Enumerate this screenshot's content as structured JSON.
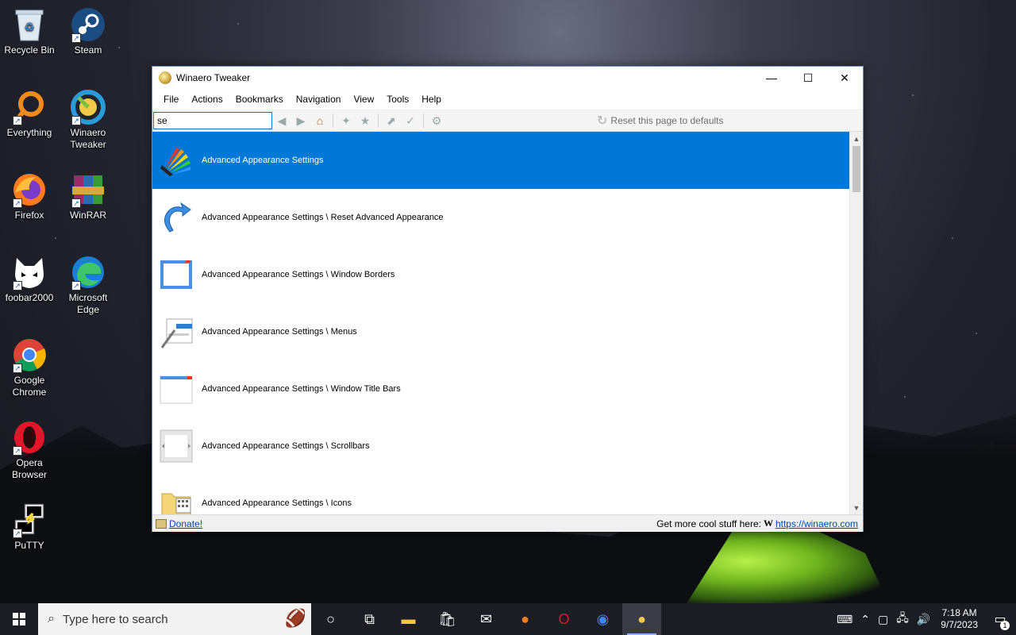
{
  "desktop": {
    "icons": [
      {
        "label": "Recycle Bin"
      },
      {
        "label": "Steam"
      },
      {
        "label": "Everything"
      },
      {
        "label": "Winaero Tweaker"
      },
      {
        "label": "Firefox"
      },
      {
        "label": "WinRAR"
      },
      {
        "label": "foobar2000"
      },
      {
        "label": "Microsoft Edge"
      },
      {
        "label": "Google Chrome"
      },
      {
        "label": "Opera Browser"
      },
      {
        "label": "PuTTY"
      }
    ]
  },
  "window": {
    "title": "Winaero Tweaker",
    "menu": [
      "File",
      "Actions",
      "Bookmarks",
      "Navigation",
      "View",
      "Tools",
      "Help"
    ],
    "search_value": "se",
    "reset_label": "Reset this page to defaults",
    "results": [
      {
        "label": "Advanced Appearance Settings",
        "icon": "palette-icon",
        "selected": true
      },
      {
        "label": "Advanced Appearance Settings \\ Reset Advanced Appearance",
        "icon": "reset-arrow-icon"
      },
      {
        "label": "Advanced Appearance Settings \\ Window Borders",
        "icon": "window-borders-icon"
      },
      {
        "label": "Advanced Appearance Settings \\ Menus",
        "icon": "menus-icon"
      },
      {
        "label": "Advanced Appearance Settings \\ Window Title Bars",
        "icon": "title-bars-icon"
      },
      {
        "label": "Advanced Appearance Settings \\ Scrollbars",
        "icon": "scrollbars-icon"
      },
      {
        "label": "Advanced Appearance Settings \\ Icons",
        "icon": "icons-icon"
      }
    ],
    "status": {
      "donate": "Donate!",
      "promo": "Get more cool stuff here:",
      "w_glyph": "W",
      "link": "https://winaero.com"
    }
  },
  "taskbar": {
    "search_placeholder": "Type here to search",
    "time": "7:18 AM",
    "date": "9/7/2023",
    "notification_count": "1"
  },
  "colors": {
    "accent": "#0078d7",
    "taskbar": "#1c1d24"
  }
}
